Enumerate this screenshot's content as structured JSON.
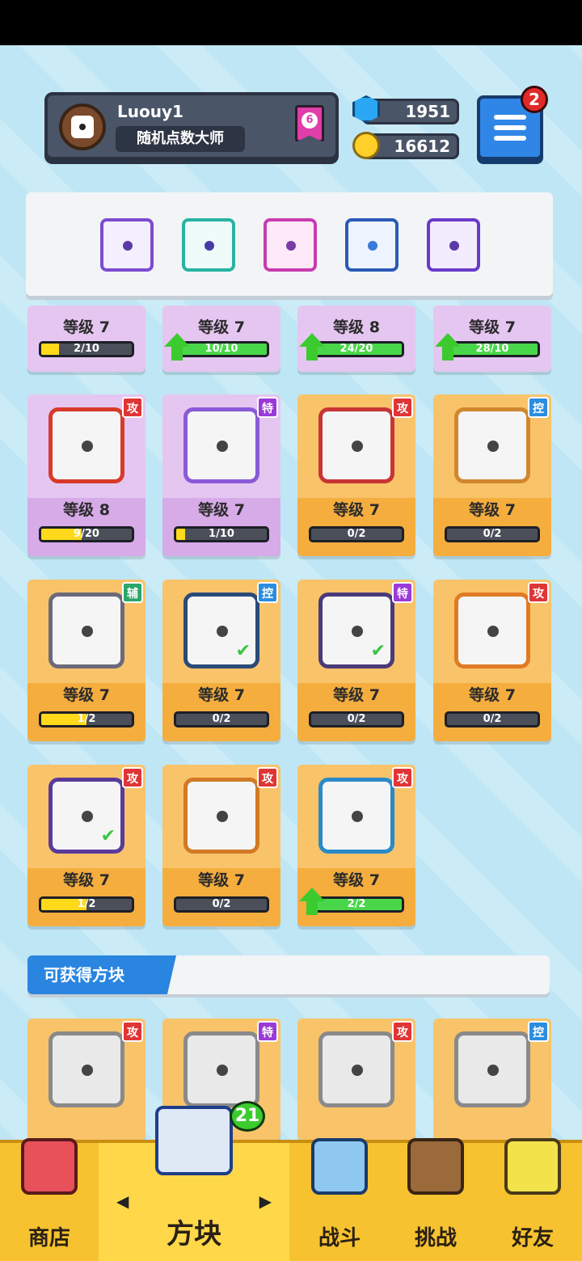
{
  "profile": {
    "name": "Luouy1",
    "title": "随机点数大师",
    "rank": "6",
    "gems": "1951",
    "coins": "16612",
    "menu_badge": "2"
  },
  "deck": [
    {
      "icon": "vortex-dice-icon"
    },
    {
      "icon": "healing-hands-dice-icon"
    },
    {
      "icon": "arrows-dice-icon"
    },
    {
      "icon": "snowflake-dice-icon"
    },
    {
      "icon": "orbit-dice-icon"
    }
  ],
  "owned_row0": [
    {
      "level": "等级 7",
      "progress": "2/10",
      "fill": 0.2,
      "upgrade": false
    },
    {
      "level": "等级 7",
      "progress": "10/10",
      "fill": 1.0,
      "upgrade": true
    },
    {
      "level": "等级 8",
      "progress": "24/20",
      "fill": 1.0,
      "upgrade": true
    },
    {
      "level": "等级 7",
      "progress": "28/10",
      "fill": 1.0,
      "upgrade": true
    }
  ],
  "owned": [
    {
      "tag": "攻",
      "tag_color": "#e03535",
      "rarity": "purple",
      "level": "等级 8",
      "progress": "9/20",
      "fill": 0.45,
      "upgrade": false,
      "icon": "fire-dice-icon",
      "frame": "#d83a2a",
      "checked": false
    },
    {
      "tag": "特",
      "tag_color": "#9a3ad8",
      "rarity": "purple",
      "level": "等级 7",
      "progress": "1/10",
      "fill": 0.1,
      "upgrade": false,
      "icon": "broken-dice-icon",
      "frame": "#8a5ad8",
      "checked": false
    },
    {
      "tag": "攻",
      "tag_color": "#e03535",
      "rarity": "orange",
      "level": "等级 7",
      "progress": "0/2",
      "fill": 0,
      "upgrade": false,
      "icon": "starburst-dice-icon",
      "frame": "#c93434",
      "checked": false
    },
    {
      "tag": "控",
      "tag_color": "#2a8de0",
      "rarity": "orange",
      "level": "等级 7",
      "progress": "0/2",
      "fill": 0,
      "upgrade": false,
      "icon": "sand-dice-icon",
      "frame": "#d0872d",
      "checked": false
    },
    {
      "tag": "辅",
      "tag_color": "#2aa66a",
      "rarity": "orange",
      "level": "等级 7",
      "progress": "1/2",
      "fill": 0.5,
      "upgrade": false,
      "icon": "jaws-dice-icon",
      "frame": "#6a6a7a",
      "checked": false
    },
    {
      "tag": "控",
      "tag_color": "#2a8de0",
      "rarity": "orange",
      "level": "等级 7",
      "progress": "0/2",
      "fill": 0,
      "upgrade": false,
      "icon": "ice-dice-icon",
      "frame": "#2a4a78",
      "checked": true
    },
    {
      "tag": "特",
      "tag_color": "#9a3ad8",
      "rarity": "orange",
      "level": "等级 7",
      "progress": "0/2",
      "fill": 0,
      "upgrade": false,
      "icon": "dark-vortex-dice-icon",
      "frame": "#4a3a7a",
      "checked": true
    },
    {
      "tag": "攻",
      "tag_color": "#e03535",
      "rarity": "orange",
      "level": "等级 7",
      "progress": "0/2",
      "fill": 0,
      "upgrade": false,
      "icon": "sun-dice-icon",
      "frame": "#e07a25",
      "checked": false
    },
    {
      "tag": "攻",
      "tag_color": "#e03535",
      "rarity": "orange",
      "level": "等级 7",
      "progress": "1/2",
      "fill": 0.5,
      "upgrade": false,
      "icon": "orbit-dice-icon",
      "frame": "#5a3a9a",
      "checked": true
    },
    {
      "tag": "攻",
      "tag_color": "#e03535",
      "rarity": "orange",
      "level": "等级 7",
      "progress": "0/2",
      "fill": 0,
      "upgrade": false,
      "icon": "gun-dice-icon",
      "frame": "#d27a25",
      "checked": false
    },
    {
      "tag": "攻",
      "tag_color": "#e03535",
      "rarity": "orange",
      "level": "等级 7",
      "progress": "2/2",
      "fill": 1.0,
      "upgrade": true,
      "icon": "whirlpool-dice-icon",
      "frame": "#2a8ac8",
      "checked": false
    }
  ],
  "available_section": {
    "title": "可获得方块"
  },
  "available": [
    {
      "tag": "攻",
      "tag_color": "#e03535",
      "icon": "gear-dice-icon"
    },
    {
      "tag": "特",
      "tag_color": "#9a3ad8",
      "icon": "infinity-dice-icon"
    },
    {
      "tag": "攻",
      "tag_color": "#e03535",
      "icon": "trident-dice-icon"
    },
    {
      "tag": "控",
      "tag_color": "#2a8de0",
      "icon": "shield-dice-icon"
    }
  ],
  "nav": {
    "shop": "商店",
    "blocks": "方块",
    "blocks_badge": "21",
    "battle": "战斗",
    "challenge": "挑战",
    "friends": "好友",
    "prev": "◀",
    "next": "▶"
  },
  "colors": {
    "accent": "#2a85e0",
    "nav_bg": "#f6c22f",
    "page_bg": "#bfe6f4"
  }
}
